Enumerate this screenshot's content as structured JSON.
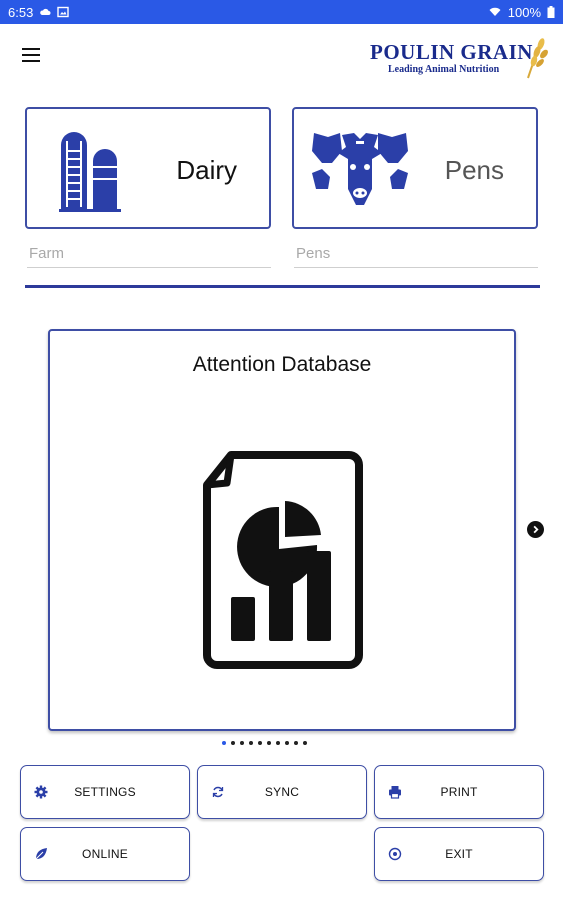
{
  "status_bar": {
    "time": "6:53",
    "battery": "100%",
    "background_color": "#2a59e6"
  },
  "header": {
    "menu_icon": "hamburger-menu-icon",
    "logo": {
      "title": "POULIN GRAIN",
      "tagline": "Leading Animal Nutrition"
    }
  },
  "selectors": {
    "farm_card": {
      "label": "Dairy",
      "icon": "silo-icon"
    },
    "pens_card": {
      "label": "Pens",
      "icon": "cow-heads-icon"
    },
    "farm_field": {
      "placeholder": "Farm",
      "value": ""
    },
    "pens_field": {
      "placeholder": "Pens",
      "value": ""
    }
  },
  "carousel": {
    "slides": [
      {
        "title": "Attention Database",
        "icon": "report-chart-icon"
      }
    ],
    "page_count": 10,
    "active_page": 1,
    "next_icon": "chevron-right-circle-icon"
  },
  "actions": {
    "settings_label": "SETTINGS",
    "sync_label": "SYNC",
    "print_label": "PRINT",
    "online_label": "ONLINE",
    "exit_label": "EXIT"
  },
  "colors": {
    "accent": "#3e4ea5",
    "brand": "#1a2b8c",
    "divider": "#2d3a9a"
  }
}
